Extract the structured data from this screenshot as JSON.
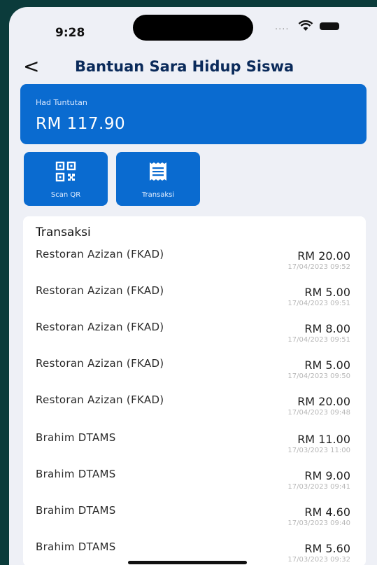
{
  "status_bar": {
    "time": "9:28",
    "signal_dots": "....",
    "icons": [
      "wifi-icon",
      "battery-icon"
    ]
  },
  "header": {
    "back_glyph": "<",
    "title": "Bantuan Sara Hidup Siswa"
  },
  "balance": {
    "label": "Had Tuntutan",
    "amount": "RM 117.90"
  },
  "actions": [
    {
      "label": "Scan QR",
      "icon": "qr-code-icon"
    },
    {
      "label": "Transaksi",
      "icon": "receipt-icon"
    }
  ],
  "transactions": {
    "heading": "Transaksi",
    "items": [
      {
        "merchant": "Restoran Azizan (FKAD)",
        "amount": "RM 20.00",
        "time": "17/04/2023 09:52"
      },
      {
        "merchant": "Restoran Azizan (FKAD)",
        "amount": "RM 5.00",
        "time": "17/04/2023 09:51"
      },
      {
        "merchant": "Restoran Azizan (FKAD)",
        "amount": "RM 8.00",
        "time": "17/04/2023 09:51"
      },
      {
        "merchant": "Restoran Azizan (FKAD)",
        "amount": "RM 5.00",
        "time": "17/04/2023 09:50"
      },
      {
        "merchant": "Restoran Azizan (FKAD)",
        "amount": "RM 20.00",
        "time": "17/04/2023 09:48"
      },
      {
        "merchant": "Brahim DTAMS",
        "amount": "RM 11.00",
        "time": "17/03/2023 11:00"
      },
      {
        "merchant": "Brahim DTAMS",
        "amount": "RM 9.00",
        "time": "17/03/2023 09:41"
      },
      {
        "merchant": "Brahim DTAMS",
        "amount": "RM 4.60",
        "time": "17/03/2023 09:40"
      },
      {
        "merchant": "Brahim DTAMS",
        "amount": "RM 5.60",
        "time": "17/03/2023 09:32"
      }
    ]
  },
  "colors": {
    "accent": "#0a6bd0",
    "background": "#eef0f6",
    "frame": "#0b3b3b"
  }
}
